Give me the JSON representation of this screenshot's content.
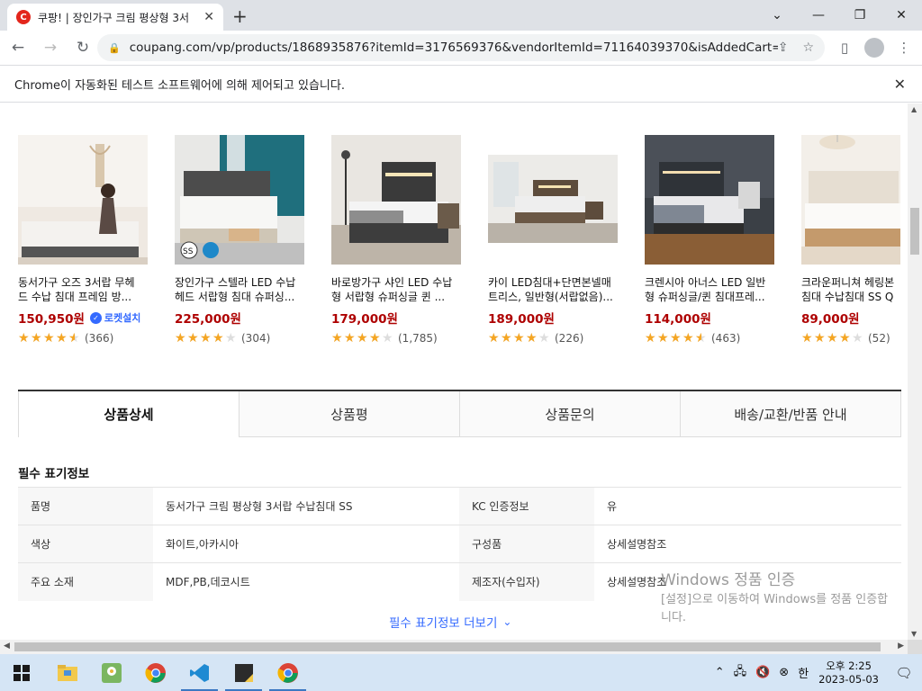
{
  "browser": {
    "tab_title": "쿠팡! | 장인가구 크림 평상형 3서",
    "favicon_letter": "C",
    "url": "coupang.com/vp/products/1868935876?itemId=3176569376&vendorItemId=71164039370&isAddedCart=",
    "infobar_text": "Chrome이 자동화된 테스트 소프트웨어에 의해 제어되고 있습니다."
  },
  "products": [
    {
      "name": "동서가구 오즈 3서랍 무헤드 수납 침대 프레임 방...",
      "price": "150,950원",
      "badge": "로켓설치",
      "rating": 4.5,
      "reviews": "(366)",
      "image": "bedroom-woman-photo"
    },
    {
      "name": "장인가구 스텔라 LED 수납헤드 서랍형 침대 슈퍼싱...",
      "price": "225,000원",
      "badge": "",
      "rating": 4.0,
      "reviews": "(304)",
      "image": "white-bed-teal-wall-photo"
    },
    {
      "name": "바로방가구 샤인 LED 수납형 서랍형 슈퍼싱글 퀸 ...",
      "price": "179,000원",
      "badge": "",
      "rating": 4.0,
      "reviews": "(1,785)",
      "image": "dark-bed-lamp-photo"
    },
    {
      "name": "카이 LED침대+단면본넬매트리스, 일반형(서랍없음)...",
      "price": "189,000원",
      "badge": "",
      "rating": 4.0,
      "reviews": "(226)",
      "image": "walnut-bed-window-photo"
    },
    {
      "name": "크렌시아 아너스 LED 일반형 슈퍼싱글/퀸 침대프레...",
      "price": "114,000원",
      "badge": "",
      "rating": 4.5,
      "reviews": "(463)",
      "image": "gray-bed-wood-floor-photo"
    },
    {
      "name": "크라운퍼니쳐 헤링본 침대 수납침대 SS Q",
      "price": "89,000원",
      "badge": "",
      "rating": 4.0,
      "reviews": "(52)",
      "image": "light-bed-pendant-photo"
    }
  ],
  "tabs": [
    "상품상세",
    "상품평",
    "상품문의",
    "배송/교환/반품 안내"
  ],
  "required_info": {
    "title": "필수 표기정보",
    "rows": [
      [
        "품명",
        "동서가구 크림 평상형 3서랍 수납침대 SS",
        "KC 인증정보",
        "유"
      ],
      [
        "색상",
        "화이트,아카시아",
        "구성품",
        "상세설명참조"
      ],
      [
        "주요 소재",
        "MDF,PB,데코시트",
        "제조자(수입자)",
        "상세설명참조"
      ]
    ],
    "more_label": "필수 표기정보 더보기"
  },
  "watermark": {
    "line1": "Windows 정품 인증",
    "line2": "[설정]으로 이동하여 Windows를 정품 인증합니다."
  },
  "taskbar": {
    "time": "오후 2:25",
    "date": "2023-05-03",
    "ime": "한"
  }
}
